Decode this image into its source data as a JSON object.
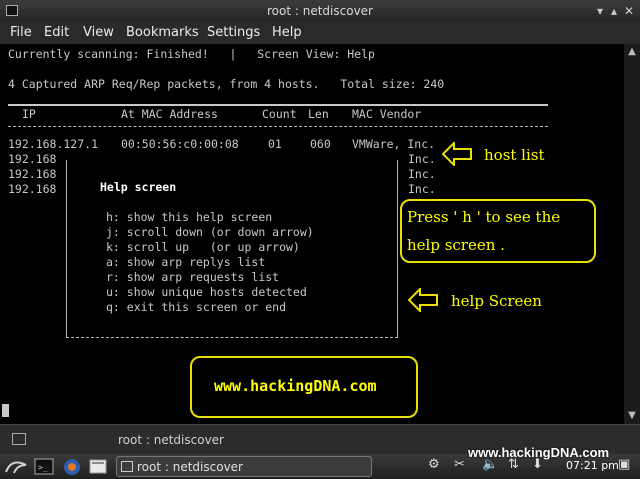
{
  "window": {
    "title": "root : netdiscover"
  },
  "menu": [
    "File",
    "Edit",
    "View",
    "Bookmarks",
    "Settings",
    "Help"
  ],
  "terminal": {
    "status_line": "Currently scanning: Finished!   |   Screen View: Help",
    "summary_line": "4 Captured ARP Req/Rep packets, from 4 hosts.   Total size: 240",
    "header": {
      "ip": "IP",
      "mac": "At MAC Address",
      "count": "Count",
      "len": "Len",
      "vendor": "MAC Vendor"
    },
    "rows": [
      {
        "ip": "192.168.127.1",
        "mac": "00:50:56:c0:00:08",
        "count": "01",
        "len": "060",
        "vendor": "VMWare, Inc."
      },
      {
        "ip": "192.168",
        "vendor": "Inc."
      },
      {
        "ip": "192.168",
        "vendor": "Inc."
      },
      {
        "ip": "192.168",
        "vendor": "Inc."
      }
    ],
    "help": {
      "title": "Help screen",
      "items": [
        "h: show this help screen",
        "j: scroll down (or down arrow)",
        "k: scroll up   (or up arrow)",
        "a: show arp replys list",
        "r: show arp requests list",
        "u: show unique hosts detected",
        "q: exit this screen or end"
      ]
    }
  },
  "annotations": {
    "host_list": "host list",
    "press_h_line1": "Press ' h ' to see the",
    "press_h_line2": "help screen .",
    "help_screen": "help Screen",
    "site": "www.hackingDNA.com",
    "color": "#ffff00"
  },
  "tab": {
    "label": "root : netdiscover"
  },
  "taskbar": {
    "task_label": "root : netdiscover",
    "brand": "www.hackingDNA.com",
    "clock": "07:21 pm"
  }
}
